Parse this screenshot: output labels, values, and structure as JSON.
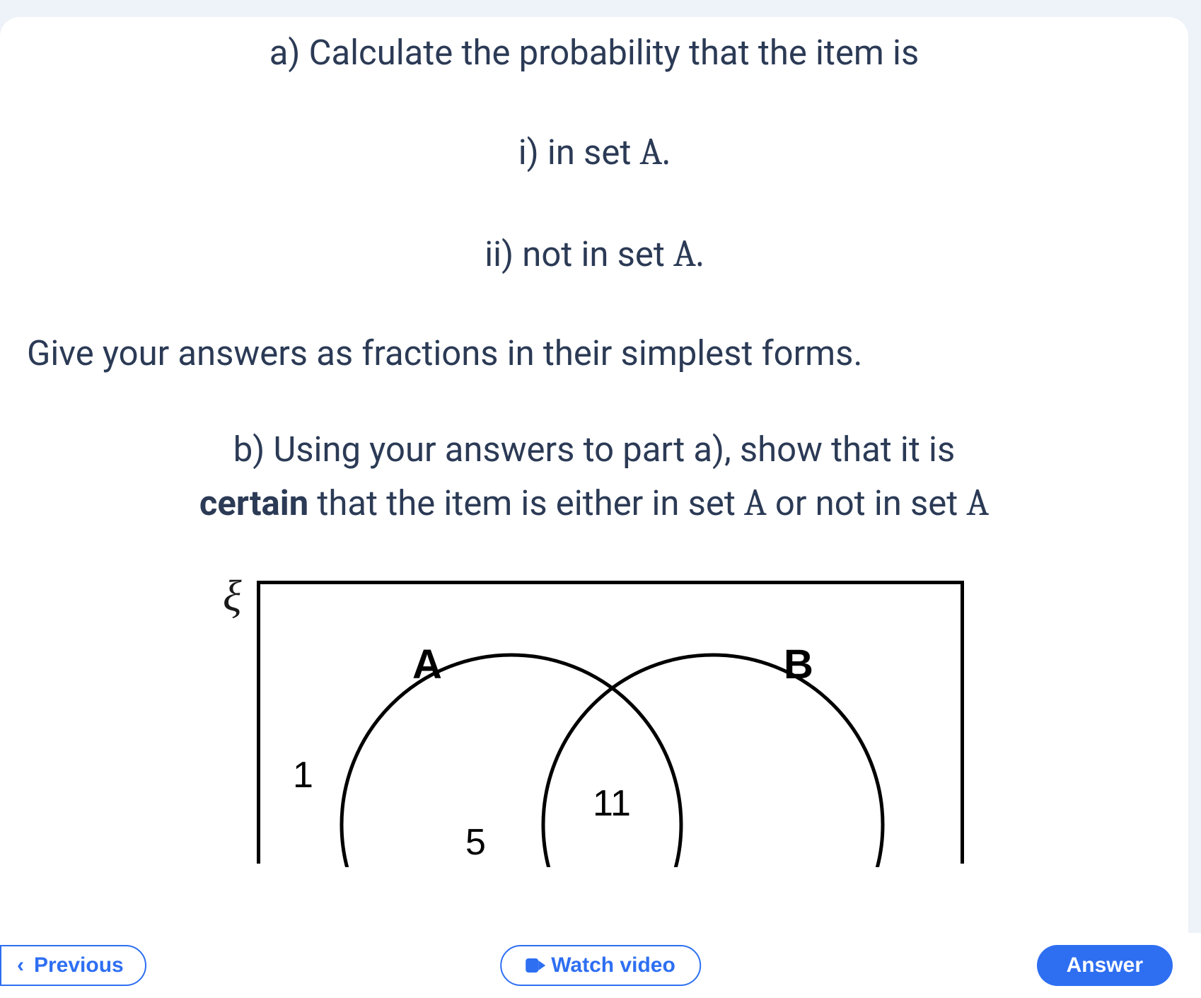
{
  "question": {
    "part_a": "a) Calculate the probability that the item is",
    "part_a_i_prefix": "i) in set ",
    "part_a_i_set": "A.",
    "part_a_ii_prefix": "ii) not in set ",
    "part_a_ii_set": "A.",
    "simplest": "Give your answers as fractions in their simplest forms.",
    "part_b_line1_pre": "b) Using your answers to part a), show that it is",
    "part_b_certain": "certain",
    "part_b_line2_mid1": " that the item is either in set ",
    "part_b_setA1": "A",
    "part_b_line2_mid2": " or not in set ",
    "part_b_setA2": "A"
  },
  "venn": {
    "universal_symbol": "ξ",
    "labelA": "A",
    "labelB": "B",
    "outside_left": "1",
    "onlyA": "5",
    "intersection": "11"
  },
  "nav": {
    "previous": "Previous",
    "watch": "Watch video",
    "answer": "Answer"
  }
}
